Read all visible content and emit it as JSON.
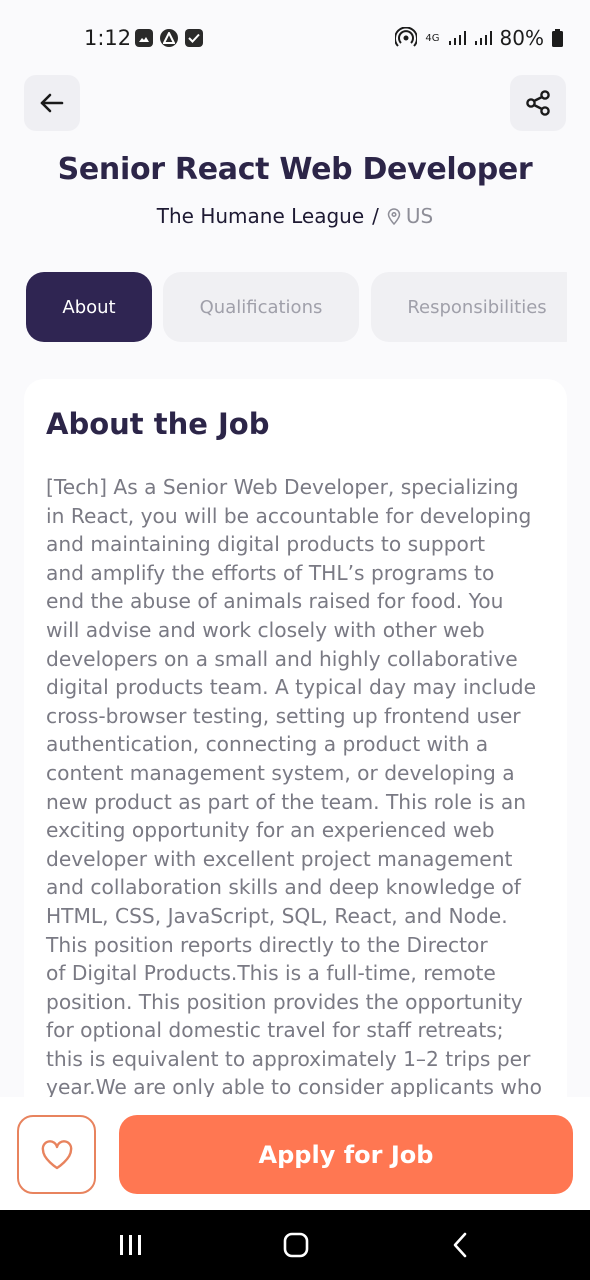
{
  "status_bar": {
    "time": "1:12",
    "battery": "80%",
    "network": "4G"
  },
  "header": {
    "back_icon": "arrow-left-icon",
    "share_icon": "share-icon",
    "job_title": "Senior React Web Developer",
    "company": "The Humane League",
    "separator": "/",
    "location": "US"
  },
  "tabs": [
    {
      "label": "About",
      "active": true
    },
    {
      "label": "Qualifications",
      "active": false
    },
    {
      "label": "Responsibilities",
      "active": false
    }
  ],
  "about": {
    "heading": "About the Job",
    "lines": [
      "[Tech] As a Senior Web Developer, specializing",
      "in React, you will be accountable for developing",
      "and maintaining digital products to support",
      "and amplify the efforts of THL’s programs to",
      "end the abuse of animals raised for food. You",
      "will advise and work closely with other web",
      "developers on a small and highly collaborative",
      "digital products team. A typical day may include",
      "cross-browser testing, setting up frontend user",
      "authentication, connecting a product with a",
      "content management system, or developing a",
      "new product as part of the team. This role is an",
      "exciting opportunity for an experienced web",
      "developer with excellent project management",
      "and collaboration skills and deep knowledge of",
      "HTML, CSS, JavaScript, SQL, React, and Node.",
      "This position reports directly to the Director",
      "of Digital Products.This is a full-time, remote",
      "position. This position provides the opportunity",
      "for optional domestic travel for staff retreats;",
      "this is equivalent to approximately 1–2 trips per",
      "year.We are only able to consider applicants who"
    ]
  },
  "actions": {
    "favorite_icon": "heart-icon",
    "apply_label": "Apply for Job"
  },
  "colors": {
    "primary_dark": "#2F2552",
    "accent_orange": "#FF7752",
    "text_muted": "#7A7A84"
  }
}
